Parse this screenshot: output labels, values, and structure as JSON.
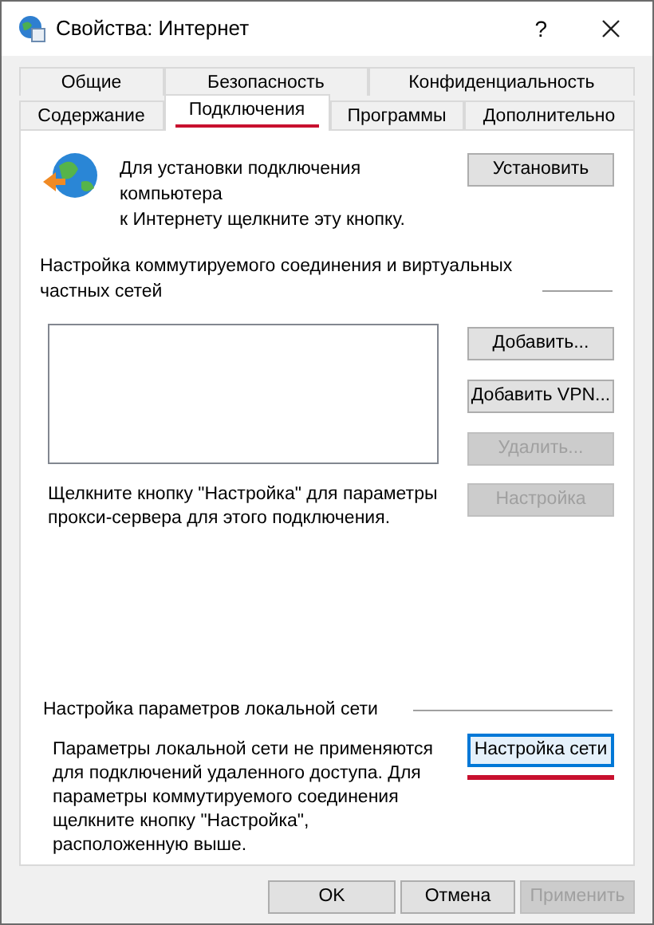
{
  "window": {
    "title": "Свойства: Интернет",
    "help_button": "?"
  },
  "tabs": [
    [
      {
        "label": "Общие",
        "selected": false
      },
      {
        "label": "Безопасность",
        "selected": false
      },
      {
        "label": "Конфиденциальность",
        "selected": false
      }
    ],
    [
      {
        "label": "Содержание",
        "selected": false
      },
      {
        "label": "Подключения",
        "selected": true,
        "annotated": true
      },
      {
        "label": "Программы",
        "selected": false
      },
      {
        "label": "Дополнительно",
        "selected": false
      }
    ]
  ],
  "setup": {
    "text": "Для установки подключения компьютера\nк Интернету щелкните эту кнопку.",
    "button": {
      "label": "Установить",
      "disabled": false
    }
  },
  "dialup": {
    "heading": "Настройка коммутируемого соединения и виртуальных\nчастных сетей",
    "buttons": [
      {
        "label": "Добавить...",
        "disabled": false
      },
      {
        "label": "Добавить VPN...",
        "disabled": false
      },
      {
        "label": "Удалить...",
        "disabled": true
      }
    ],
    "proxy_note": "Щелкните кнопку \"Настройка\" для параметры\nпрокси-сервера для этого подключения.",
    "settings_button": {
      "label": "Настройка",
      "disabled": true
    }
  },
  "lan": {
    "heading": "Настройка параметров локальной сети",
    "note": "Параметры локальной сети не применяются\nдля подключений удаленного доступа. Для\nпараметры коммутируемого соединения\nщелкните кнопку \"Настройка\",\nрасположенную выше.",
    "button": {
      "label": "Настройка сети",
      "disabled": false,
      "focused": true,
      "annotated": true
    }
  },
  "footer": [
    {
      "label": "OK",
      "disabled": false
    },
    {
      "label": "Отмена",
      "disabled": false
    },
    {
      "label": "Применить",
      "disabled": true
    }
  ]
}
